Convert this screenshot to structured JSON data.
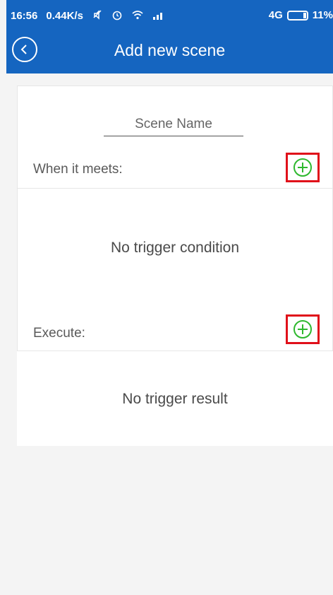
{
  "status_bar": {
    "time": "16:56",
    "net_speed": "0.44K/s",
    "network": "4G",
    "battery": "11%"
  },
  "header": {
    "title": "Add new scene",
    "back_icon": "back-circle-icon"
  },
  "form": {
    "scene_name_placeholder": "Scene Name",
    "scene_name_value": ""
  },
  "conditions": {
    "label": "When it meets:",
    "empty_text": "No trigger condition",
    "add_icon": "plus-circle-icon"
  },
  "actions": {
    "label": "Execute:",
    "empty_text": "No trigger result",
    "add_icon": "plus-circle-icon"
  },
  "colors": {
    "header_bg": "#1565c0",
    "add_icon": "#2eb82e",
    "highlight_border": "#e0101a"
  }
}
